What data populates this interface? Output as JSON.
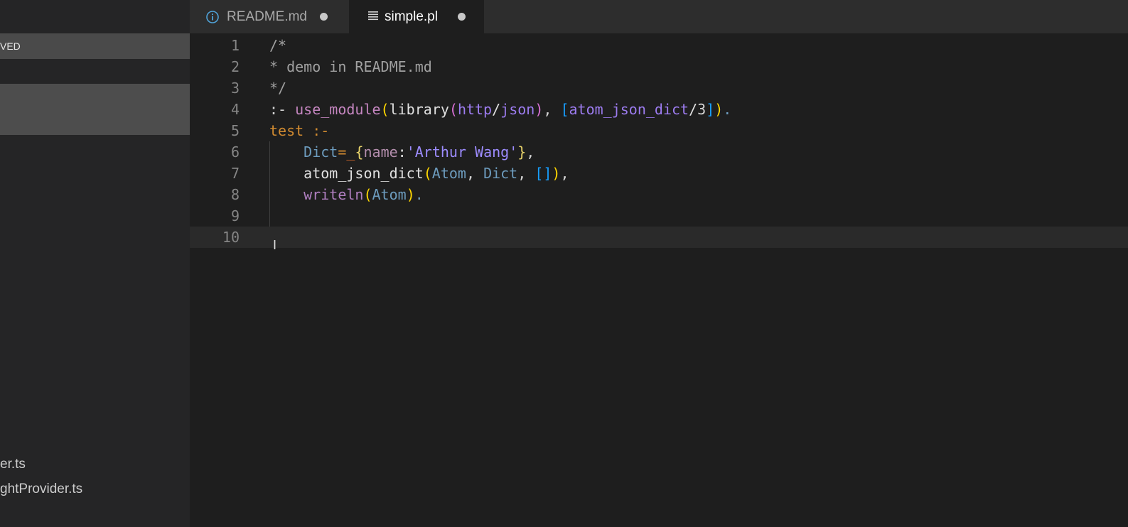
{
  "sidebar": {
    "section_header": "VED",
    "files": [
      {
        "label": "er.ts"
      },
      {
        "label": "ghtProvider.ts"
      }
    ]
  },
  "tabs": [
    {
      "label": "README.md",
      "icon": "info-icon",
      "modified": true,
      "active": false
    },
    {
      "label": "simple.pl",
      "icon": "file-lines-icon",
      "modified": true,
      "active": true
    }
  ],
  "editor": {
    "current_line": 10,
    "lines": [
      {
        "num": "1",
        "tokens": [
          {
            "t": "/*",
            "c": "c-comment"
          }
        ]
      },
      {
        "num": "2",
        "tokens": [
          {
            "t": "* demo in README.md",
            "c": "c-comment"
          }
        ]
      },
      {
        "num": "3",
        "tokens": [
          {
            "t": "*/",
            "c": "c-comment"
          }
        ]
      },
      {
        "num": "4",
        "tokens": [
          {
            "t": ":- ",
            "c": "c-op"
          },
          {
            "t": "use_module",
            "c": "c-pred"
          },
          {
            "t": "(",
            "c": "c-paren1"
          },
          {
            "t": "library",
            "c": "c-plain"
          },
          {
            "t": "(",
            "c": "c-paren2"
          },
          {
            "t": "http",
            "c": "c-atom"
          },
          {
            "t": "/",
            "c": "c-plain"
          },
          {
            "t": "json",
            "c": "c-atom"
          },
          {
            "t": ")",
            "c": "c-paren2"
          },
          {
            "t": ", ",
            "c": "c-op"
          },
          {
            "t": "[",
            "c": "c-bracket"
          },
          {
            "t": "atom_json_dict",
            "c": "c-atom"
          },
          {
            "t": "/",
            "c": "c-plain"
          },
          {
            "t": "3",
            "c": "c-num"
          },
          {
            "t": "]",
            "c": "c-bracket"
          },
          {
            "t": ")",
            "c": "c-paren1"
          },
          {
            "t": ".",
            "c": "c-var"
          }
        ]
      },
      {
        "num": "5",
        "tokens": [
          {
            "t": "test",
            "c": "c-head"
          },
          {
            "t": " :-",
            "c": "c-eq"
          }
        ]
      },
      {
        "num": "6",
        "tokens": [
          {
            "t": "    ",
            "c": "c-op"
          },
          {
            "t": "Dict",
            "c": "c-var"
          },
          {
            "t": "=",
            "c": "c-eq"
          },
          {
            "t": "_",
            "c": "c-under"
          },
          {
            "t": "{",
            "c": "c-brace"
          },
          {
            "t": "name",
            "c": "c-key"
          },
          {
            "t": ":",
            "c": "c-plain"
          },
          {
            "t": "'Arthur Wang'",
            "c": "c-str"
          },
          {
            "t": "}",
            "c": "c-brace"
          },
          {
            "t": ",",
            "c": "c-op"
          }
        ]
      },
      {
        "num": "7",
        "tokens": [
          {
            "t": "    ",
            "c": "c-op"
          },
          {
            "t": "atom_json_dict",
            "c": "c-plain"
          },
          {
            "t": "(",
            "c": "c-paren1"
          },
          {
            "t": "Atom",
            "c": "c-var"
          },
          {
            "t": ", ",
            "c": "c-op"
          },
          {
            "t": "Dict",
            "c": "c-var"
          },
          {
            "t": ", ",
            "c": "c-op"
          },
          {
            "t": "[]",
            "c": "c-bracket"
          },
          {
            "t": ")",
            "c": "c-paren1"
          },
          {
            "t": ",",
            "c": "c-op"
          }
        ]
      },
      {
        "num": "8",
        "tokens": [
          {
            "t": "    ",
            "c": "c-op"
          },
          {
            "t": "writeln",
            "c": "c-write"
          },
          {
            "t": "(",
            "c": "c-paren1"
          },
          {
            "t": "Atom",
            "c": "c-var"
          },
          {
            "t": ")",
            "c": "c-paren1"
          },
          {
            "t": ".",
            "c": "c-var"
          }
        ]
      },
      {
        "num": "9",
        "tokens": []
      },
      {
        "num": "10",
        "tokens": []
      }
    ]
  }
}
